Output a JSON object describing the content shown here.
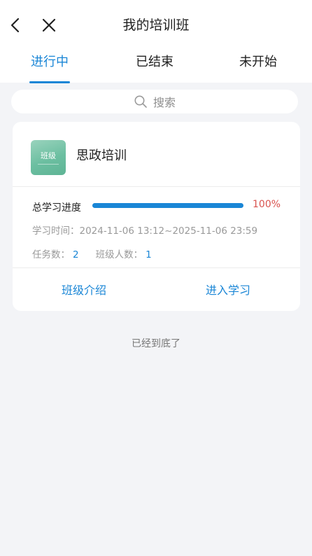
{
  "header": {
    "title": "我的培训班",
    "back_icon": "chevron-left-icon",
    "close_icon": "close-icon"
  },
  "tabs": [
    {
      "label": "进行中",
      "active": true
    },
    {
      "label": "已结束",
      "active": false
    },
    {
      "label": "未开始",
      "active": false
    }
  ],
  "search": {
    "placeholder": "搜索",
    "icon": "search-icon"
  },
  "course": {
    "thumbnail_text": "班级",
    "name": "思政培训",
    "progress_label": "总学习进度",
    "progress_value": 1.0,
    "progress_text": "100%",
    "study_time": "学习时间：2024-11-06 13:12~2025-11-06 23:59",
    "task_label": "任务数：",
    "task_count": "2",
    "members_label": "班级人数：",
    "members_count": "1",
    "intro_button": "班级介绍",
    "enter_button": "进入学习"
  },
  "footer": {
    "end_text": "已经到底了"
  },
  "colors": {
    "accent": "#1a86d6",
    "percent": "#d9534f",
    "background": "#f3f4f7"
  }
}
